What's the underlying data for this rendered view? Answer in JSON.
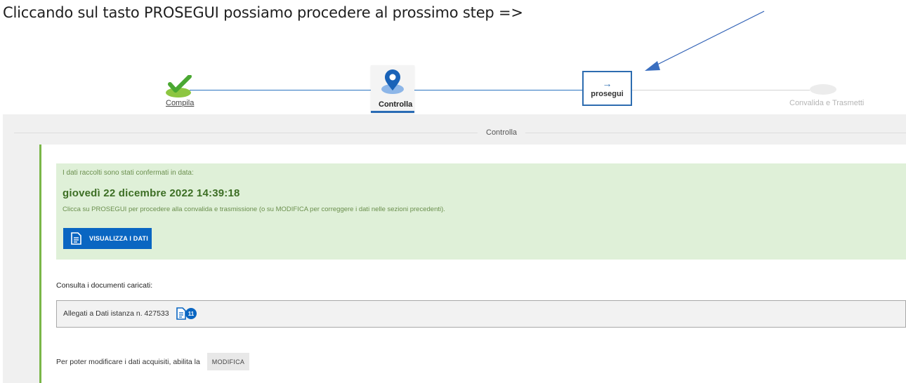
{
  "caption": "Cliccando sul tasto PROSEGUI possiamo procedere al prossimo step =>",
  "stepper": {
    "steps": [
      {
        "label": "Compila",
        "state": "done",
        "icon": "check-icon"
      },
      {
        "label": "Controlla",
        "state": "current",
        "icon": "location-pin-icon"
      },
      {
        "label": "Convalida e Trasmetti",
        "state": "pending",
        "icon": "step-placeholder-icon"
      }
    ],
    "prosegui": {
      "arrow": "→",
      "label": "prosegui"
    }
  },
  "section": {
    "title": "Controlla"
  },
  "confirmation": {
    "line1": "I dati raccolti sono stati confermati in data:",
    "date": "giovedì 22 dicembre 2022 14:39:18",
    "line2": "Clicca su PROSEGUI per procedere alla convalida e trasmissione (o su MODIFICA per correggere i dati nelle sezioni precedenti).",
    "view_button": "VISUALIZZA I DATI"
  },
  "documents": {
    "title": "Consulta i documenti caricati:",
    "item": "Allegati a Dati istanza n. 427533",
    "count": "11"
  },
  "modify": {
    "text": "Per poter modificare i dati acquisiti, abilita la",
    "button": "MODIFICA"
  },
  "colors": {
    "accent": "#0a66c2",
    "success_bg": "#dff0d8",
    "success_border": "#7ab648",
    "annotation": "#2d6cb0"
  }
}
